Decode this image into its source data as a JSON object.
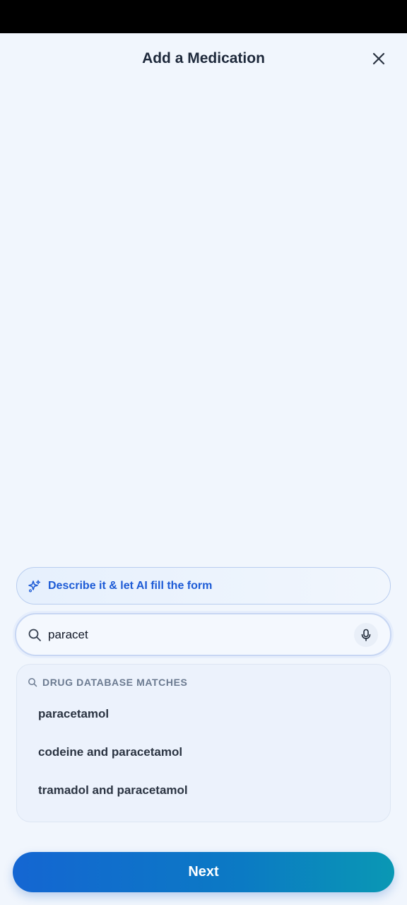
{
  "header": {
    "title": "Add a Medication",
    "close_icon": "close-icon"
  },
  "ai_fill": {
    "label": "Describe it & let AI fill the form",
    "icon": "sparkles-icon"
  },
  "search": {
    "value": "paracet",
    "icon": "search-icon",
    "mic_icon": "microphone-icon"
  },
  "results": {
    "title": "DRUG DATABASE MATCHES",
    "items": [
      "paracetamol",
      "codeine and paracetamol",
      "tramadol and paracetamol"
    ]
  },
  "footer": {
    "next_label": "Next"
  },
  "colors": {
    "accent": "#1d5bd6",
    "background": "#f1f6fd",
    "button_gradient_start": "#1466d2",
    "button_gradient_end": "#0a98b4"
  }
}
